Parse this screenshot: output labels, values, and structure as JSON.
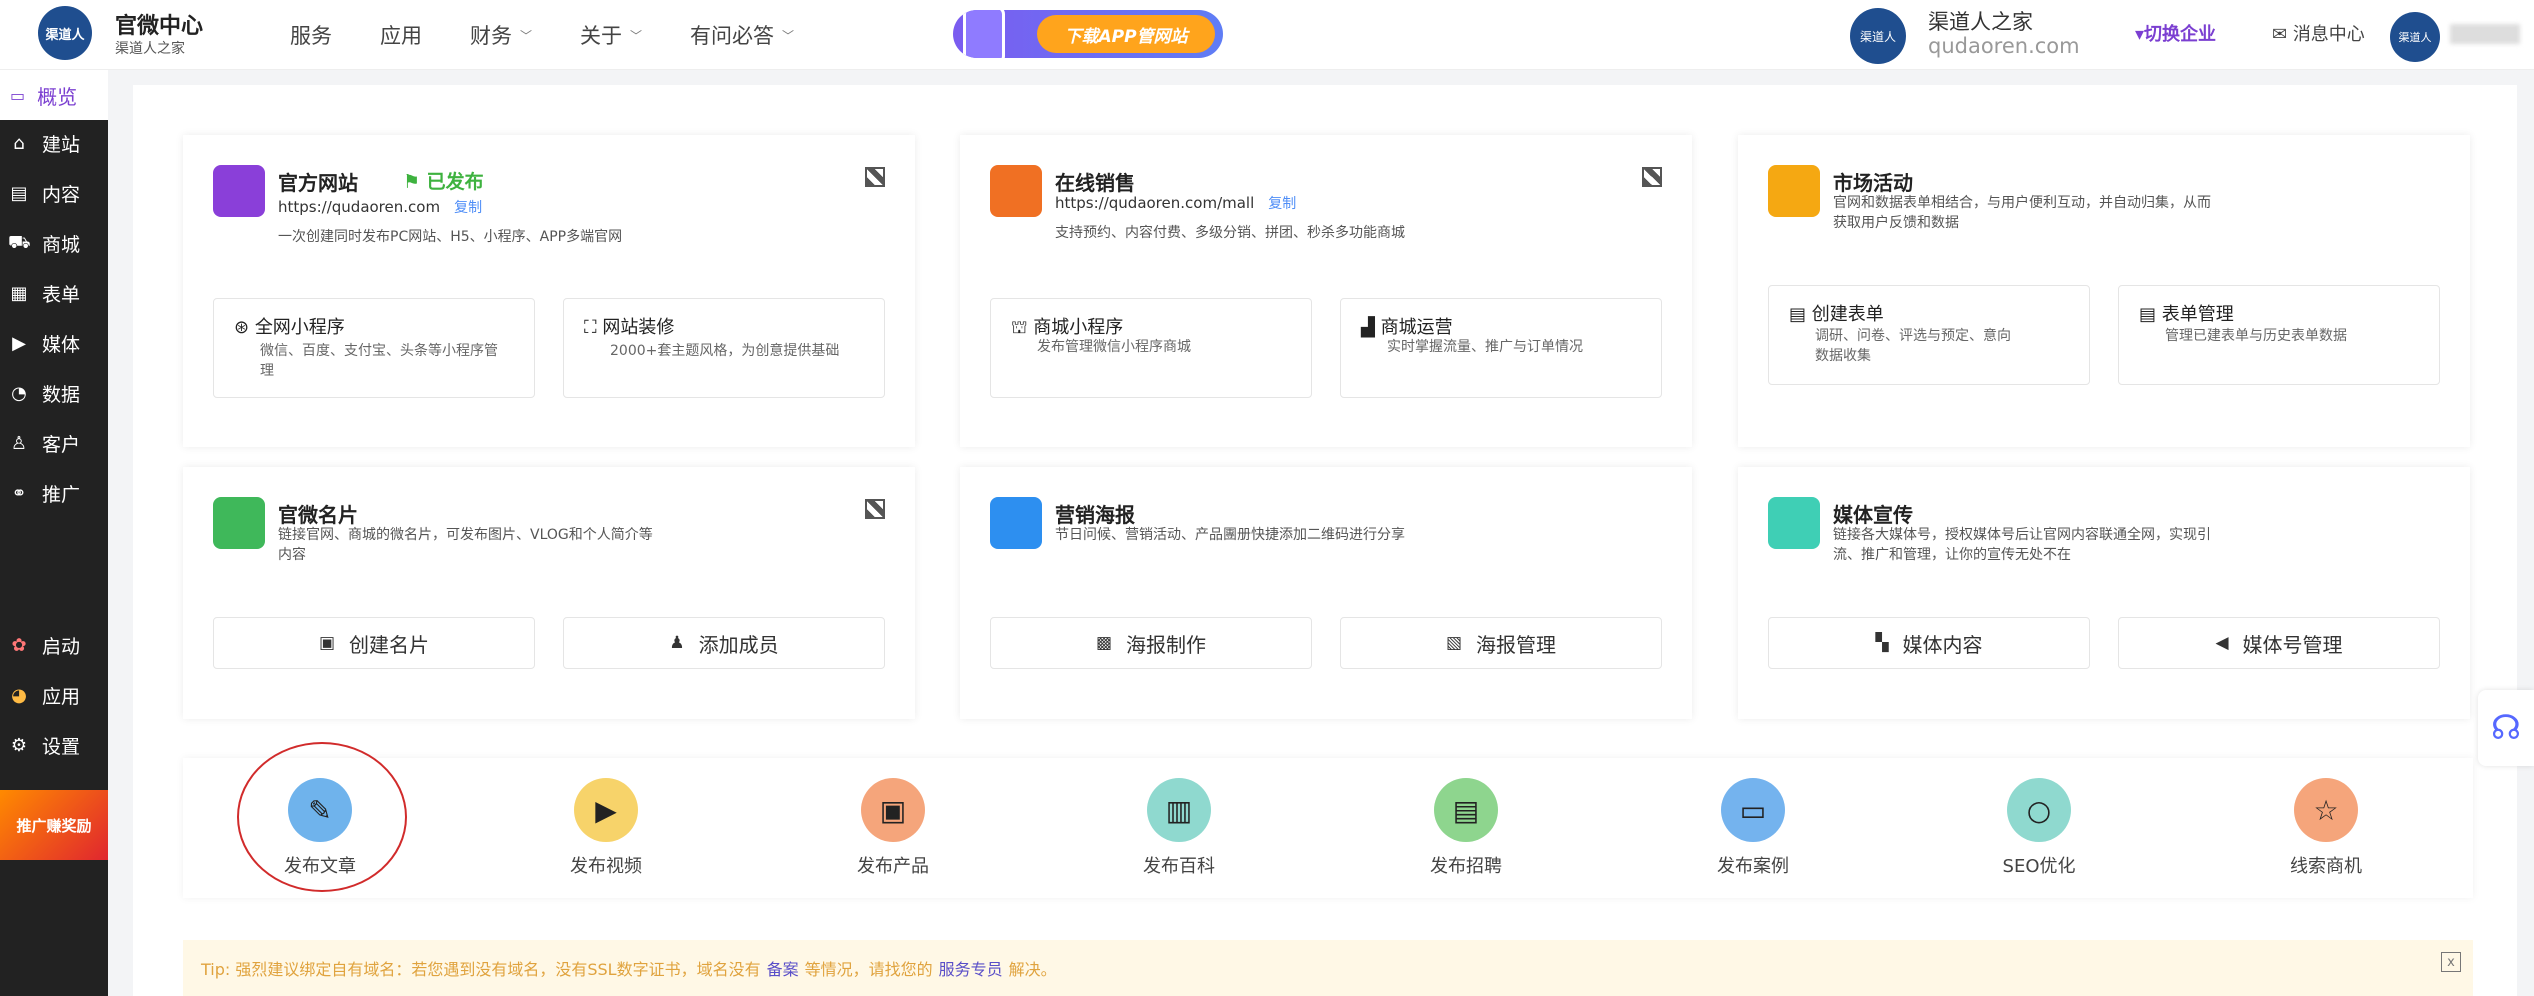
{
  "header": {
    "logo_text": "渠道人",
    "brand_title": "官微中心",
    "brand_sub": "渠道人之家",
    "nav": [
      {
        "label": "服务",
        "has_dropdown": false
      },
      {
        "label": "应用",
        "has_dropdown": false
      },
      {
        "label": "财务",
        "has_dropdown": true
      },
      {
        "label": "关于",
        "has_dropdown": true
      },
      {
        "label": "有问必答",
        "has_dropdown": true
      }
    ],
    "banner_text": "下载APP管网站",
    "company_logo_text": "渠道人",
    "company_name": "渠道人之家",
    "company_domain": "qudaoren.com",
    "switch_label": "切换企业",
    "message_label": "消息中心",
    "avatar_text": "渠道人"
  },
  "sidebar": {
    "active": "概览",
    "items": [
      "建站",
      "内容",
      "商城",
      "表单",
      "媒体",
      "数据",
      "客户",
      "推广"
    ],
    "bottom_items": [
      "启动",
      "应用",
      "设置"
    ],
    "promo_label": "推广赚奖励"
  },
  "cards": {
    "website": {
      "title": "官方网站",
      "status": "已发布",
      "url": "https://qudaoren.com",
      "copy": "复制",
      "desc": "一次创建同时发布PC网站、H5、小程序、APP多端官网",
      "sub1_title": "全网小程序",
      "sub1_desc": "微信、百度、支付宝、头条等小程序管理",
      "sub2_title": "网站装修",
      "sub2_desc": "2000+套主题风格，为创意提供基础"
    },
    "sales": {
      "title": "在线销售",
      "url": "https://qudaoren.com/mall",
      "copy": "复制",
      "desc": "支持预约、内容付费、多级分销、拼团、秒杀多功能商城",
      "sub1_title": "商城小程序",
      "sub1_desc": "发布管理微信小程序商城",
      "sub2_title": "商城运营",
      "sub2_desc": "实时掌握流量、推广与订单情况"
    },
    "market": {
      "title": "市场活动",
      "desc": "官网和数据表单相结合，与用户便利互动，并自动归集，从而获取用户反馈和数据",
      "sub1_title": "创建表单",
      "sub1_desc": "调研、问卷、评选与预定、意向数据收集",
      "sub2_title": "表单管理",
      "sub2_desc": "管理已建表单与历史表单数据"
    },
    "namecard": {
      "title": "官微名片",
      "desc": "链接官网、商城的微名片，可发布图片、VLOG和个人简介等内容",
      "btn1": "创建名片",
      "btn2": "添加成员"
    },
    "poster": {
      "title": "营销海报",
      "desc": "节日问候、营销活动、产品團册快捷添加二维码进行分享",
      "btn1": "海报制作",
      "btn2": "海报管理"
    },
    "media": {
      "title": "媒体宣传",
      "desc": "链接各大媒体号，授权媒体号后让官网内容联通全网，实现引流、推广和管理，让你的宣传无处不在",
      "btn1": "媒体内容",
      "btn2": "媒体号管理"
    }
  },
  "quick_actions": [
    {
      "label": "发布文章",
      "icon": "edit-icon",
      "color": "#6fb3ec"
    },
    {
      "label": "发布视频",
      "icon": "play-icon",
      "color": "#f7d36a"
    },
    {
      "label": "发布产品",
      "icon": "box-icon",
      "color": "#f5a57b"
    },
    {
      "label": "发布百科",
      "icon": "book-icon",
      "color": "#8fd9cf"
    },
    {
      "label": "发布招聘",
      "icon": "document-icon",
      "color": "#8ed58e"
    },
    {
      "label": "发布案例",
      "icon": "inbox-icon",
      "color": "#74b3ee"
    },
    {
      "label": "SEO优化",
      "icon": "search-icon",
      "color": "#8fd9cf"
    },
    {
      "label": "线索商机",
      "icon": "star-icon",
      "color": "#f5a57b"
    }
  ],
  "tip": {
    "prefix": "Tip: 强烈建议绑定自有域名：若您遇到没有域名，没有SSL数字证书，域名没有",
    "link1": "备案",
    "middle": "等情况，请找您的",
    "link2": "服务专员",
    "suffix": "解决。",
    "close": "x"
  }
}
